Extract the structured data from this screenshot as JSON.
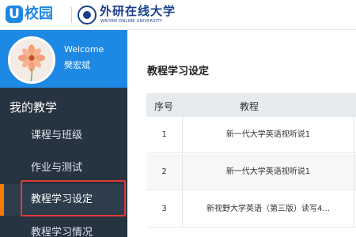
{
  "header": {
    "logo_mark": "U",
    "logo_text": "校园",
    "partner_cn": "外研在线大学",
    "partner_en": "WAIYAN ONLINE UNIVERSITY"
  },
  "profile": {
    "welcome": "Welcome",
    "username": "樊宏斌"
  },
  "sidebar": {
    "section_title": "我的教学",
    "items": [
      {
        "label": "课程与班级"
      },
      {
        "label": "作业与测试"
      },
      {
        "label": "教程学习设定"
      },
      {
        "label": "教程学习情况"
      }
    ],
    "active_index": 2,
    "accent_color": "#f57c00"
  },
  "main": {
    "title": "教程学习设定",
    "table": {
      "headers": {
        "no": "序号",
        "course": "教程"
      },
      "rows": [
        {
          "no": "1",
          "course": "新一代大学英语视听说1"
        },
        {
          "no": "2",
          "course": "新一代大学英语视听说1"
        },
        {
          "no": "3",
          "course": "新视野大学英语（第三版）读写4..."
        }
      ]
    }
  },
  "colors": {
    "brand_blue": "#1e88e5",
    "sidebar_bg": "#263340",
    "highlight_red": "#e53935"
  }
}
